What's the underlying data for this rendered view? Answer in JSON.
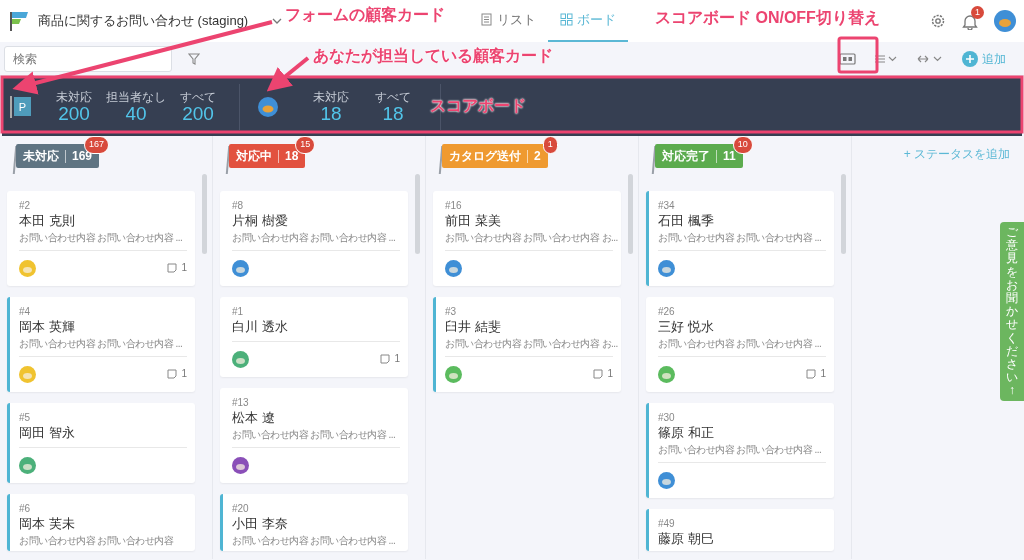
{
  "header": {
    "title": "商品に関するお問い合わせ (staging)",
    "views": [
      {
        "label": "リスト",
        "kind": "list",
        "selected": false
      },
      {
        "label": "ボード",
        "kind": "board",
        "selected": true
      }
    ],
    "notification_count": "1"
  },
  "toolbar": {
    "search": {
      "placeholder": "検索"
    },
    "add_label": "追加"
  },
  "scoreboard": {
    "visible": true,
    "groups": [
      {
        "kind": "form",
        "letter": "P",
        "stats": [
          {
            "label": "未対応",
            "value": "200"
          },
          {
            "label": "担当者なし",
            "value": "40"
          },
          {
            "label": "すべて",
            "value": "200"
          }
        ]
      },
      {
        "kind": "mine",
        "stats": [
          {
            "label": "未対応",
            "value": "18"
          },
          {
            "label": "すべて",
            "value": "18"
          }
        ]
      }
    ]
  },
  "columns": [
    {
      "name": "未対応",
      "count": "169",
      "badge": "167",
      "color": "#5f7482",
      "cards": [
        {
          "number": "#2",
          "name": "本田 克則",
          "summary": "お問い合わせ内容 お問い合わせ内容 ...",
          "mine": false,
          "avatar": {
            "color": "#f0c330"
          },
          "comments": "1"
        },
        {
          "number": "#4",
          "name": "岡本 英輝",
          "summary": "お問い合わせ内容 お問い合わせ内容 ...",
          "mine": true,
          "avatar": {
            "color": "#f0c330"
          },
          "comments": "1"
        },
        {
          "number": "#5",
          "name": "岡田 智永",
          "mine": true,
          "avatar": {
            "color": "#4cb07a"
          }
        },
        {
          "number": "#6",
          "name": "岡本 芙未",
          "summary": "お問い合わせ内容 お問い合わせ内容",
          "mine": true
        }
      ]
    },
    {
      "name": "対応中",
      "count": "18",
      "badge": "15",
      "color": "#e2513f",
      "cards": [
        {
          "number": "#8",
          "name": "片桐 樹愛",
          "summary": "お問い合わせ内容 お問い合わせ内容 ...",
          "mine": false,
          "avatar": {
            "color": "#3f8fd6"
          }
        },
        {
          "number": "#1",
          "name": "白川 透水",
          "mine": false,
          "avatar": {
            "color": "#4cb07a"
          },
          "comments": "1"
        },
        {
          "number": "#13",
          "name": "松本 遼",
          "summary": "お問い合わせ内容 お問い合わせ内容 ...",
          "mine": false,
          "avatar": {
            "color": "#8a4fb8"
          }
        },
        {
          "number": "#20",
          "name": "小田 李奈",
          "summary": "お問い合わせ内容 お問い合わせ内容 ...",
          "mine": true
        }
      ]
    },
    {
      "name": "カタログ送付",
      "count": "2",
      "badge": "1",
      "color": "#ef9a30",
      "cards": [
        {
          "number": "#16",
          "name": "前田 菜美",
          "summary": "お問い合わせ内容 お問い合わせ内容 お...",
          "mine": false,
          "avatar": {
            "color": "#3f8fd6"
          }
        },
        {
          "number": "#3",
          "name": "臼井 結斐",
          "summary": "お問い合わせ内容 お問い合わせ内容 お...",
          "mine": true,
          "avatar": {
            "color": "#5bbb5e"
          },
          "comments": "1"
        }
      ]
    },
    {
      "name": "対応完了",
      "count": "11",
      "badge": "10",
      "color": "#5cab4e",
      "cards": [
        {
          "number": "#34",
          "name": "石田 楓季",
          "summary": "お問い合わせ内容 お問い合わせ内容 ...",
          "mine": true,
          "avatar": {
            "color": "#3f8fd6"
          }
        },
        {
          "number": "#26",
          "name": "三好 悦水",
          "summary": "お問い合わせ内容 お問い合わせ内容 ...",
          "mine": false,
          "avatar": {
            "color": "#5bbb5e"
          },
          "comments": "1"
        },
        {
          "number": "#30",
          "name": "篠原 和正",
          "summary": "お問い合わせ内容 お問い合わせ内容 ...",
          "mine": true,
          "avatar": {
            "color": "#3f8fd6"
          }
        },
        {
          "number": "#49",
          "name": "藤原 朝巳",
          "mine": true
        }
      ]
    }
  ],
  "add_status": "+ ステータスを追加",
  "feedback_tab": "ご意見をお聞かせください↑",
  "annotations": [
    {
      "kind": "form_card",
      "text": "フォームの顧客カード"
    },
    {
      "kind": "my_card",
      "text": "あなたが担当している顧客カード"
    },
    {
      "kind": "toggle",
      "text": "スコアボード ON/OFF切り替え"
    },
    {
      "kind": "scoreboard",
      "text": "スコアボード"
    }
  ]
}
